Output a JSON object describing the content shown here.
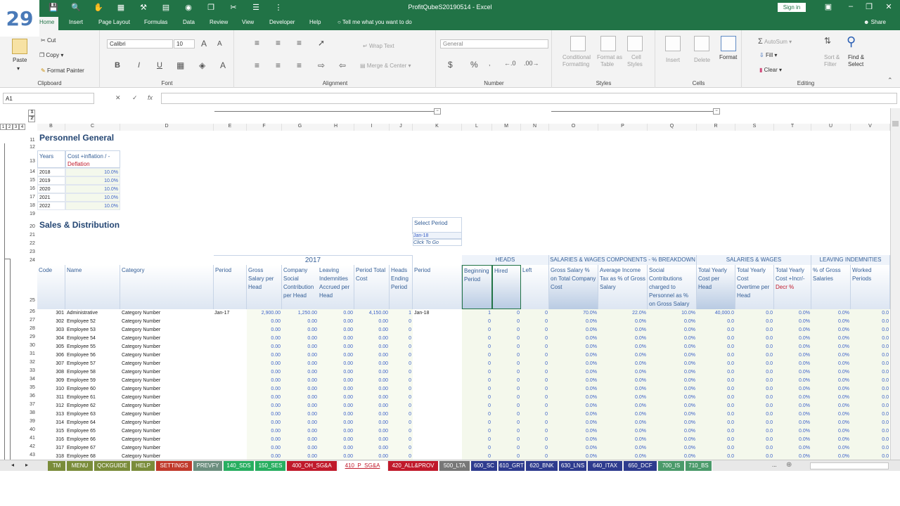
{
  "badge": "29",
  "window": {
    "title": "ProfitQubeS20190514  -  Excel",
    "signin": "Sign in",
    "share": "Share",
    "tell_me": "Tell me what you want to do"
  },
  "menu_tabs": [
    "Home",
    "Insert",
    "Page Layout",
    "Formulas",
    "Data",
    "Review",
    "View",
    "Developer",
    "Help"
  ],
  "ribbon": {
    "clipboard": {
      "label": "Clipboard",
      "paste": "Paste",
      "cut": "Cut",
      "copy": "Copy",
      "format_painter": "Format Painter"
    },
    "font": {
      "label": "Font",
      "font_name": "Calibri",
      "font_size": "10",
      "bold": "B",
      "italic": "I",
      "underline": "U"
    },
    "alignment": {
      "label": "Alignment",
      "wrap_text": "Wrap Text",
      "merge_center": "Merge & Center"
    },
    "number": {
      "label": "Number",
      "format": "General",
      "currency": "$",
      "percent": "%"
    },
    "styles": {
      "label": "Styles",
      "conditional": "Conditional",
      "formatting": "Formatting",
      "format_as": "Format as",
      "table": "Table",
      "cell": "Cell",
      "styles": "Styles"
    },
    "cells": {
      "label": "Cells",
      "insert": "Insert",
      "delete": "Delete",
      "format": "Format"
    },
    "editing": {
      "label": "Editing",
      "autosum": "AutoSum",
      "fill": "Fill",
      "clear": "Clear",
      "sort": "Sort &",
      "filter": "Filter",
      "find": "Find &",
      "select": "Select"
    }
  },
  "formula_bar": {
    "name_box": "A1",
    "fx": "fx",
    "content": ""
  },
  "columns": [
    "B",
    "C",
    "D",
    "E",
    "F",
    "G",
    "H",
    "I",
    "J",
    "K",
    "L",
    "M",
    "N",
    "O",
    "P",
    "Q",
    "R",
    "S",
    "T",
    "U",
    "V"
  ],
  "outline_levels": [
    "1",
    "2",
    "3",
    "4"
  ],
  "personnel": {
    "title": "Personnel General",
    "col_years": "Years",
    "col_cost_1": "Cost +inflation / -",
    "col_cost_2": "Deflation",
    "rows": [
      {
        "year": "2018",
        "value": "10.0%"
      },
      {
        "year": "2019",
        "value": "10.0%"
      },
      {
        "year": "2020",
        "value": "10.0%"
      },
      {
        "year": "2021",
        "value": "10.0%"
      },
      {
        "year": "2022",
        "value": "10.0%"
      }
    ]
  },
  "sales": {
    "title": "Sales & Distribution",
    "select_period": "Select Period",
    "period_value": "Jan-18",
    "click_to_go": "Click To Go",
    "band_2017": "2017",
    "band_heads": "HEADS",
    "band_components": "SALARIES & WAGES COMPONENTS - % BREAKDOWN",
    "band_salaries": "SALARIES & WAGES",
    "band_leaving": "LEAVING INDEMNITIES",
    "headers": {
      "code": "Code",
      "name": "Name",
      "category": "Category",
      "period": "Period",
      "gross": "Gross Salary per Head",
      "social": "Company Social Contribution per Head",
      "leaving": "Leaving Indemnities Accrued per Head",
      "total": "Period Total Cost",
      "heads_end": "Heads Ending Period",
      "period2": "Period",
      "beginning": "Beginning Period",
      "hired": "Hired",
      "left": "Left",
      "gross_pct": "Gross Salary % on Total Company Cost",
      "avg_tax": "Average Income Tax as % of Gross Salary",
      "social_pct": "Social Contributions charged to Personnel as % on Gross Salary",
      "yearly": "Total Yearly Cost per Head",
      "overtime": "Total Yearly Cost Overtime per Head",
      "incr_1": "Total Yearly Cost +Incr/-",
      "incr_2": "Decr %",
      "pct_gross": "% of Gross Salaries",
      "worked": "Worked Periods"
    },
    "first_row": {
      "code": "301",
      "name": "Administrative",
      "category": "Category Number",
      "period": "Jan-17",
      "gross": "2,900.00",
      "social": "1,250.00",
      "leaving": "0.00",
      "total": "4,150.00",
      "heads_end": "1",
      "period2": "Jan-18",
      "beginning": "1",
      "hired": "0",
      "left": "0",
      "gross_pct": "70.0%",
      "avg_tax": "22.0%",
      "social_pct": "10.0%",
      "yearly": "40,000.0",
      "overtime": "0.0",
      "incr": "0.0%",
      "pct_gross": "0.0%",
      "worked": "0.0"
    },
    "employees": [
      {
        "code": "302",
        "name": "Employee 52"
      },
      {
        "code": "303",
        "name": "Employee 53"
      },
      {
        "code": "304",
        "name": "Employee 54"
      },
      {
        "code": "305",
        "name": "Employee 55"
      },
      {
        "code": "306",
        "name": "Employee 56"
      },
      {
        "code": "307",
        "name": "Employee 57"
      },
      {
        "code": "308",
        "name": "Employee 58"
      },
      {
        "code": "309",
        "name": "Employee 59"
      },
      {
        "code": "310",
        "name": "Employee 60"
      },
      {
        "code": "311",
        "name": "Employee 61"
      },
      {
        "code": "312",
        "name": "Employee 62"
      },
      {
        "code": "313",
        "name": "Employee 63"
      },
      {
        "code": "314",
        "name": "Employee 64"
      },
      {
        "code": "315",
        "name": "Employee 65"
      },
      {
        "code": "316",
        "name": "Employee 66"
      },
      {
        "code": "317",
        "name": "Employee 67"
      },
      {
        "code": "318",
        "name": "Employee 68"
      }
    ],
    "default_row": {
      "category": "Category Number",
      "money": "0.00",
      "count": "0",
      "pct": "0.0%",
      "dec": "0.0"
    }
  },
  "row_numbers_top": [
    "1",
    "2",
    "11",
    "12",
    "13",
    "14",
    "15",
    "16",
    "17",
    "18",
    "19",
    "20",
    "21",
    "22",
    "23",
    "24",
    "25"
  ],
  "row_numbers_data": [
    "26",
    "27",
    "28",
    "29",
    "30",
    "31",
    "32",
    "33",
    "34",
    "35",
    "36",
    "37",
    "38",
    "39",
    "40",
    "41",
    "42",
    "43"
  ],
  "sheet_tabs": [
    {
      "label": "TM",
      "color": "#7a8c3a"
    },
    {
      "label": "MENU",
      "color": "#7a8c3a"
    },
    {
      "label": "QCKGUIDE",
      "color": "#7a8c3a"
    },
    {
      "label": "HELP",
      "color": "#7a8c3a"
    },
    {
      "label": "SETTINGS",
      "color": "#c0392b"
    },
    {
      "label": "PREVFY",
      "color": "#6b8e7e"
    },
    {
      "label": "140_SDS",
      "color": "#27ae60"
    },
    {
      "label": "150_SES",
      "color": "#27ae60"
    },
    {
      "label": "400_OH_SG&A",
      "color": "#c0192b"
    },
    {
      "label": "410_P_SG&A",
      "color": "#f5d5d5"
    },
    {
      "label": "420_ALL&PROV",
      "color": "#c0192b"
    },
    {
      "label": "500_LTA",
      "color": "#777777"
    },
    {
      "label": "600_SC",
      "color": "#2e3b8e"
    },
    {
      "label": "610_GRT",
      "color": "#2e3b8e"
    },
    {
      "label": "620_BNK",
      "color": "#2e3b8e"
    },
    {
      "label": "630_LNS",
      "color": "#2e3b8e"
    },
    {
      "label": "640_ITAX",
      "color": "#2e3b8e"
    },
    {
      "label": "650_DCF",
      "color": "#2e3b8e"
    },
    {
      "label": "700_IS",
      "color": "#4a9a6a"
    },
    {
      "label": "710_BS",
      "color": "#4a9a6a"
    }
  ],
  "more_tabs": "..."
}
